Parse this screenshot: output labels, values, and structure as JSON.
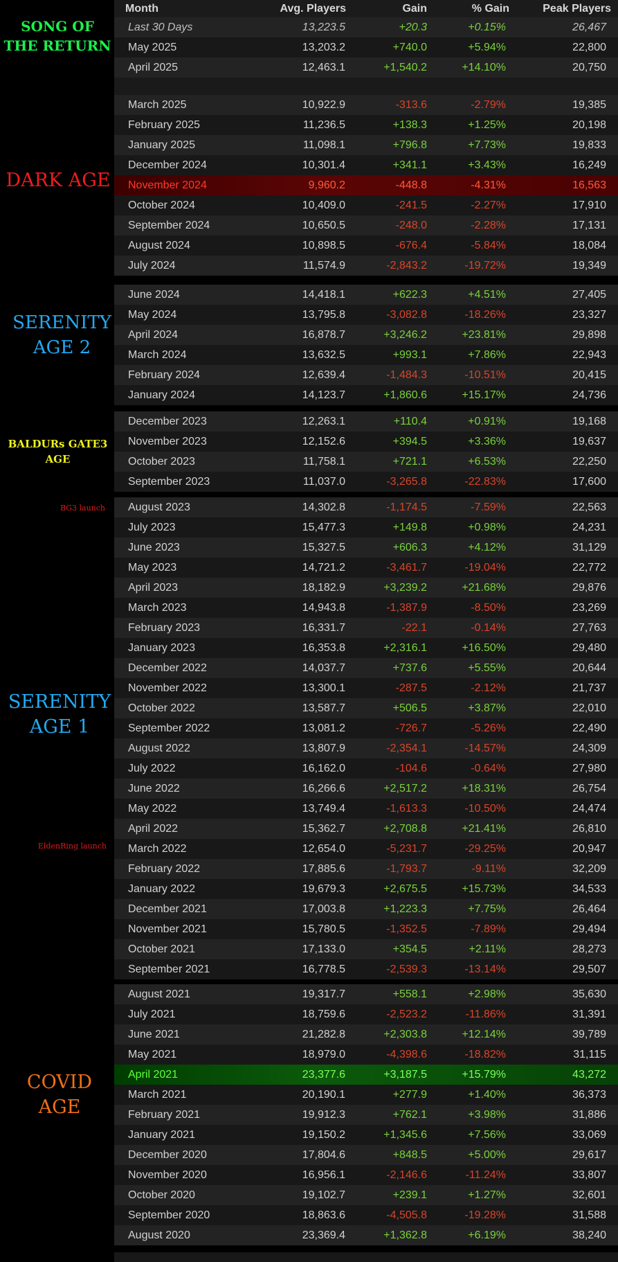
{
  "header": {
    "month": "Month",
    "avg": "Avg. Players",
    "gain": "Gain",
    "pct": "% Gain",
    "peak": "Peak Players"
  },
  "labels": {
    "song_line1": "SONG OF",
    "song_line2": "THE RETURN",
    "dark": "DARK AGE",
    "ser2_line1": "SERENITY",
    "ser2_line2": "AGE 2",
    "bg3_line1": "BALDURs GATE3",
    "bg3_line2": "AGE",
    "bg3_launch": "BG3 launch",
    "ser1_line1": "SERENITY",
    "ser1_line2": "AGE 1",
    "elden_launch": "EldenRing launch",
    "covid_line1": "COVID",
    "covid_line2": "AGE"
  },
  "colors": {
    "song": "#1cf04a",
    "dark": "#ef1c1c",
    "serenity": "#22a9f2",
    "bg3": "#eef21a",
    "launch": "#e11a1a",
    "covid": "#f07018",
    "positive": "#79d23c",
    "negative": "#d9452a"
  },
  "blocks": [
    {
      "id": "song",
      "rows": [
        {
          "month": "Last 30 Days",
          "avg": "13,223.5",
          "gain": "+20.3",
          "pct": "+0.15%",
          "peak": "26,467",
          "italic": true
        },
        {
          "month": "May 2025",
          "avg": "13,203.2",
          "gain": "+740.0",
          "pct": "+5.94%",
          "peak": "22,800"
        },
        {
          "month": "April 2025",
          "avg": "12,463.1",
          "gain": "+1,540.2",
          "pct": "+14.10%",
          "peak": "20,750"
        }
      ]
    },
    {
      "id": "dark",
      "rows": [
        {
          "month": "March 2025",
          "avg": "10,922.9",
          "gain": "-313.6",
          "pct": "-2.79%",
          "peak": "19,385"
        },
        {
          "month": "February 2025",
          "avg": "11,236.5",
          "gain": "+138.3",
          "pct": "+1.25%",
          "peak": "20,198"
        },
        {
          "month": "January 2025",
          "avg": "11,098.1",
          "gain": "+796.8",
          "pct": "+7.73%",
          "peak": "19,833"
        },
        {
          "month": "December 2024",
          "avg": "10,301.4",
          "gain": "+341.1",
          "pct": "+3.43%",
          "peak": "16,249"
        },
        {
          "month": "November 2024",
          "avg": "9,960.2",
          "gain": "-448.8",
          "pct": "-4.31%",
          "peak": "16,563",
          "highlight": "red"
        },
        {
          "month": "October 2024",
          "avg": "10,409.0",
          "gain": "-241.5",
          "pct": "-2.27%",
          "peak": "17,910"
        },
        {
          "month": "September 2024",
          "avg": "10,650.5",
          "gain": "-248.0",
          "pct": "-2.28%",
          "peak": "17,131"
        },
        {
          "month": "August 2024",
          "avg": "10,898.5",
          "gain": "-676.4",
          "pct": "-5.84%",
          "peak": "18,084"
        },
        {
          "month": "July 2024",
          "avg": "11,574.9",
          "gain": "-2,843.2",
          "pct": "-19.72%",
          "peak": "19,349"
        }
      ]
    },
    {
      "id": "ser2",
      "rows": [
        {
          "month": "June 2024",
          "avg": "14,418.1",
          "gain": "+622.3",
          "pct": "+4.51%",
          "peak": "27,405"
        },
        {
          "month": "May 2024",
          "avg": "13,795.8",
          "gain": "-3,082.8",
          "pct": "-18.26%",
          "peak": "23,327"
        },
        {
          "month": "April 2024",
          "avg": "16,878.7",
          "gain": "+3,246.2",
          "pct": "+23.81%",
          "peak": "29,898"
        },
        {
          "month": "March 2024",
          "avg": "13,632.5",
          "gain": "+993.1",
          "pct": "+7.86%",
          "peak": "22,943"
        },
        {
          "month": "February 2024",
          "avg": "12,639.4",
          "gain": "-1,484.3",
          "pct": "-10.51%",
          "peak": "20,415"
        },
        {
          "month": "January 2024",
          "avg": "14,123.7",
          "gain": "+1,860.6",
          "pct": "+15.17%",
          "peak": "24,736"
        }
      ]
    },
    {
      "id": "bg3",
      "rows": [
        {
          "month": "December 2023",
          "avg": "12,263.1",
          "gain": "+110.4",
          "pct": "+0.91%",
          "peak": "19,168"
        },
        {
          "month": "November 2023",
          "avg": "12,152.6",
          "gain": "+394.5",
          "pct": "+3.36%",
          "peak": "19,637"
        },
        {
          "month": "October 2023",
          "avg": "11,758.1",
          "gain": "+721.1",
          "pct": "+6.53%",
          "peak": "22,250"
        },
        {
          "month": "September 2023",
          "avg": "11,037.0",
          "gain": "-3,265.8",
          "pct": "-22.83%",
          "peak": "17,600"
        }
      ]
    },
    {
      "id": "ser1a",
      "rows": [
        {
          "month": "August 2023",
          "avg": "14,302.8",
          "gain": "-1,174.5",
          "pct": "-7.59%",
          "peak": "22,563"
        },
        {
          "month": "July 2023",
          "avg": "15,477.3",
          "gain": "+149.8",
          "pct": "+0.98%",
          "peak": "24,231"
        },
        {
          "month": "June 2023",
          "avg": "15,327.5",
          "gain": "+606.3",
          "pct": "+4.12%",
          "peak": "31,129"
        },
        {
          "month": "May 2023",
          "avg": "14,721.2",
          "gain": "-3,461.7",
          "pct": "-19.04%",
          "peak": "22,772"
        },
        {
          "month": "April 2023",
          "avg": "18,182.9",
          "gain": "+3,239.2",
          "pct": "+21.68%",
          "peak": "29,876"
        },
        {
          "month": "March 2023",
          "avg": "14,943.8",
          "gain": "-1,387.9",
          "pct": "-8.50%",
          "peak": "23,269"
        },
        {
          "month": "February 2023",
          "avg": "16,331.7",
          "gain": "-22.1",
          "pct": "-0.14%",
          "peak": "27,763"
        },
        {
          "month": "January 2023",
          "avg": "16,353.8",
          "gain": "+2,316.1",
          "pct": "+16.50%",
          "peak": "29,480"
        }
      ]
    },
    {
      "id": "ser1b",
      "rows": [
        {
          "month": "December 2022",
          "avg": "14,037.7",
          "gain": "+737.6",
          "pct": "+5.55%",
          "peak": "20,644"
        },
        {
          "month": "November 2022",
          "avg": "13,300.1",
          "gain": "-287.5",
          "pct": "-2.12%",
          "peak": "21,737"
        },
        {
          "month": "October 2022",
          "avg": "13,587.7",
          "gain": "+506.5",
          "pct": "+3.87%",
          "peak": "22,010"
        },
        {
          "month": "September 2022",
          "avg": "13,081.2",
          "gain": "-726.7",
          "pct": "-5.26%",
          "peak": "22,490"
        },
        {
          "month": "August 2022",
          "avg": "13,807.9",
          "gain": "-2,354.1",
          "pct": "-14.57%",
          "peak": "24,309"
        },
        {
          "month": "July 2022",
          "avg": "16,162.0",
          "gain": "-104.6",
          "pct": "-0.64%",
          "peak": "27,980"
        },
        {
          "month": "June 2022",
          "avg": "16,266.6",
          "gain": "+2,517.2",
          "pct": "+18.31%",
          "peak": "26,754"
        },
        {
          "month": "May 2022",
          "avg": "13,749.4",
          "gain": "-1,613.3",
          "pct": "-10.50%",
          "peak": "24,474"
        },
        {
          "month": "April 2022",
          "avg": "15,362.7",
          "gain": "+2,708.8",
          "pct": "+21.41%",
          "peak": "26,810"
        },
        {
          "month": "March 2022",
          "avg": "12,654.0",
          "gain": "-5,231.7",
          "pct": "-29.25%",
          "peak": "20,947"
        },
        {
          "month": "February 2022",
          "avg": "17,885.6",
          "gain": "-1,793.7",
          "pct": "-9.11%",
          "peak": "32,209"
        },
        {
          "month": "January 2022",
          "avg": "19,679.3",
          "gain": "+2,675.5",
          "pct": "+15.73%",
          "peak": "34,533"
        },
        {
          "month": "December 2021",
          "avg": "17,003.8",
          "gain": "+1,223.3",
          "pct": "+7.75%",
          "peak": "26,464"
        },
        {
          "month": "November 2021",
          "avg": "15,780.5",
          "gain": "-1,352.5",
          "pct": "-7.89%",
          "peak": "29,494"
        },
        {
          "month": "October 2021",
          "avg": "17,133.0",
          "gain": "+354.5",
          "pct": "+2.11%",
          "peak": "28,273"
        },
        {
          "month": "September 2021",
          "avg": "16,778.5",
          "gain": "-2,539.3",
          "pct": "-13.14%",
          "peak": "29,507"
        }
      ]
    },
    {
      "id": "covid",
      "rows": [
        {
          "month": "August 2021",
          "avg": "19,317.7",
          "gain": "+558.1",
          "pct": "+2.98%",
          "peak": "35,630"
        },
        {
          "month": "July 2021",
          "avg": "18,759.6",
          "gain": "-2,523.2",
          "pct": "-11.86%",
          "peak": "31,391"
        },
        {
          "month": "June 2021",
          "avg": "21,282.8",
          "gain": "+2,303.8",
          "pct": "+12.14%",
          "peak": "39,789"
        },
        {
          "month": "May 2021",
          "avg": "18,979.0",
          "gain": "-4,398.6",
          "pct": "-18.82%",
          "peak": "31,115"
        },
        {
          "month": "April 2021",
          "avg": "23,377.6",
          "gain": "+3,187.5",
          "pct": "+15.79%",
          "peak": "43,272",
          "highlight": "green"
        },
        {
          "month": "March 2021",
          "avg": "20,190.1",
          "gain": "+277.9",
          "pct": "+1.40%",
          "peak": "36,373"
        },
        {
          "month": "February 2021",
          "avg": "19,912.3",
          "gain": "+762.1",
          "pct": "+3.98%",
          "peak": "31,886"
        },
        {
          "month": "January 2021",
          "avg": "19,150.2",
          "gain": "+1,345.6",
          "pct": "+7.56%",
          "peak": "33,069"
        },
        {
          "month": "December 2020",
          "avg": "17,804.6",
          "gain": "+848.5",
          "pct": "+5.00%",
          "peak": "29,617"
        },
        {
          "month": "November 2020",
          "avg": "16,956.1",
          "gain": "-2,146.6",
          "pct": "-11.24%",
          "peak": "33,807"
        },
        {
          "month": "October 2020",
          "avg": "19,102.7",
          "gain": "+239.1",
          "pct": "+1.27%",
          "peak": "32,601"
        },
        {
          "month": "September 2020",
          "avg": "18,863.6",
          "gain": "-4,505.8",
          "pct": "-19.28%",
          "peak": "31,588"
        },
        {
          "month": "August 2020",
          "avg": "23,369.4",
          "gain": "+1,362.8",
          "pct": "+6.19%",
          "peak": "38,240"
        }
      ]
    }
  ]
}
